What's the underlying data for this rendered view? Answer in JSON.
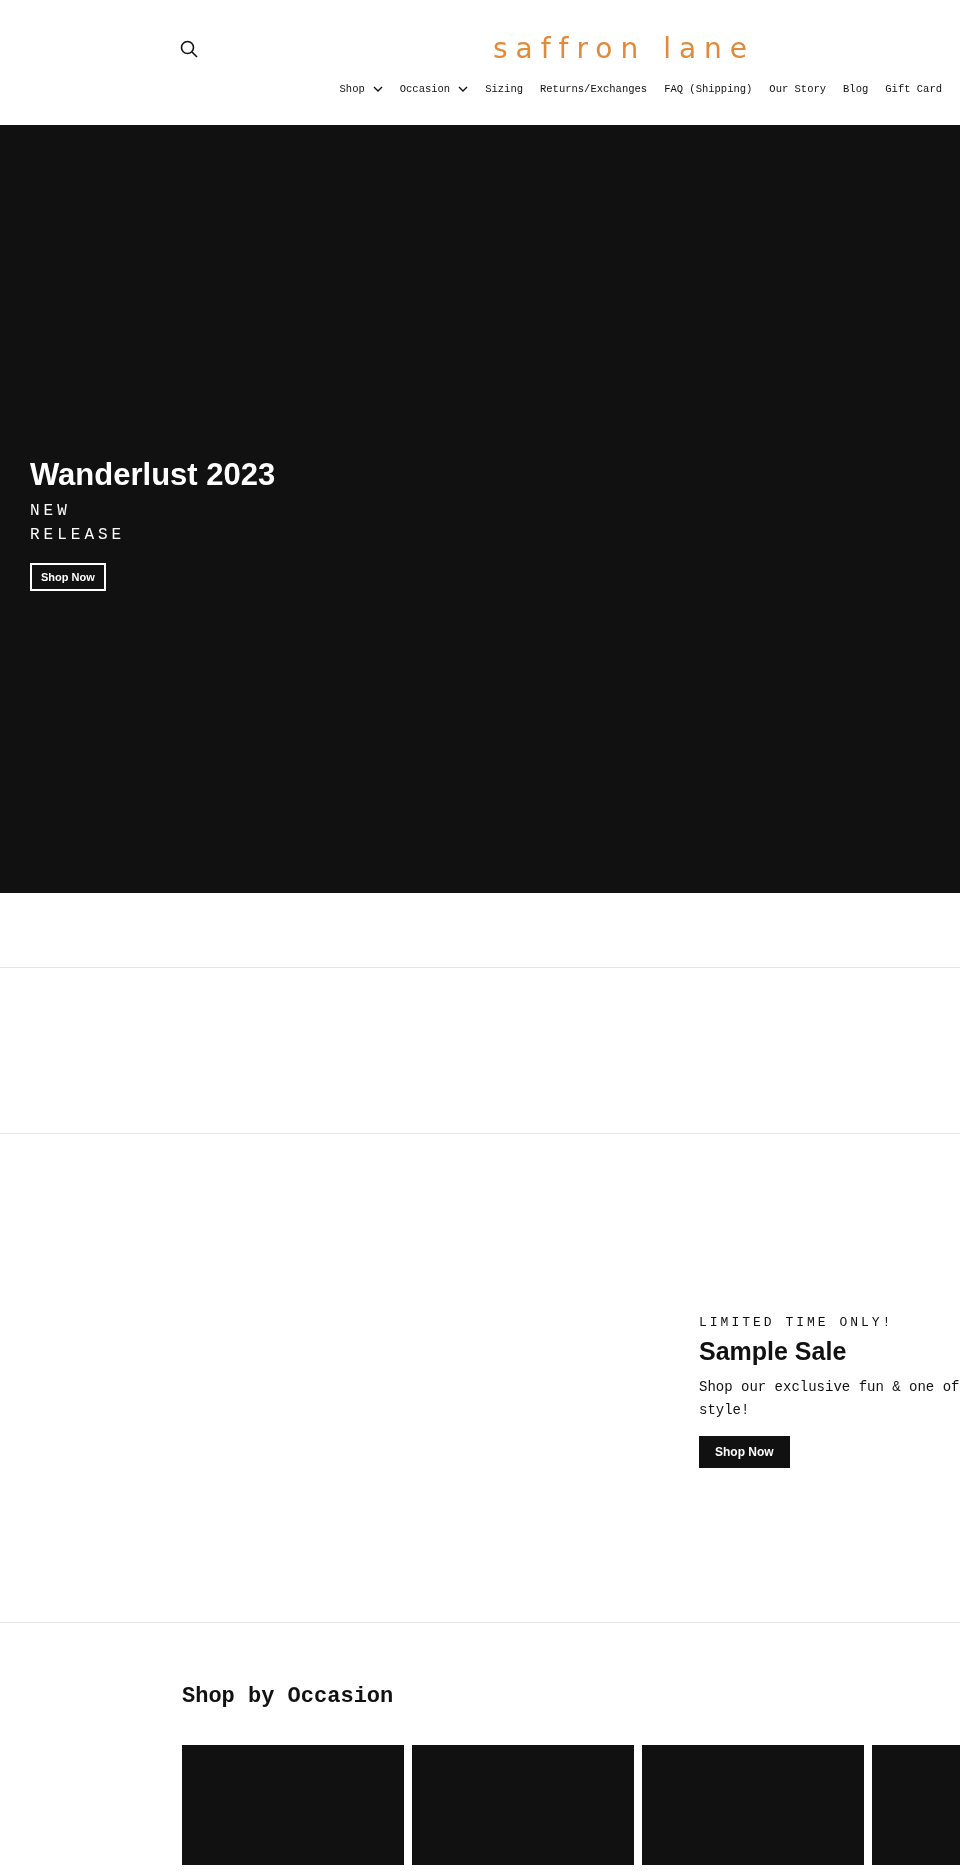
{
  "header": {
    "logo": "saffron lane",
    "nav": [
      {
        "label": "Shop",
        "dropdown": true
      },
      {
        "label": "Occasion",
        "dropdown": true
      },
      {
        "label": "Sizing",
        "dropdown": false
      },
      {
        "label": "Returns/Exchanges",
        "dropdown": false
      },
      {
        "label": "FAQ (Shipping)",
        "dropdown": false
      },
      {
        "label": "Our Story",
        "dropdown": false
      },
      {
        "label": "Blog",
        "dropdown": false
      },
      {
        "label": "Gift Card",
        "dropdown": false
      }
    ]
  },
  "hero": {
    "title": "Wanderlust 2023",
    "subtitle_lines": [
      "NEW",
      "RELEASE"
    ],
    "button": "Shop Now"
  },
  "sale": {
    "eyebrow": "LIMITED TIME ONLY!",
    "title": "Sample Sale",
    "text": "Shop our exclusive fun & one of style!",
    "button": "Shop Now"
  },
  "occasion": {
    "title": "Shop by Occasion",
    "cards": [
      {
        "kind": "tile"
      },
      {
        "kind": "tile"
      },
      {
        "kind": "tile"
      },
      {
        "kind": "tile"
      }
    ]
  }
}
